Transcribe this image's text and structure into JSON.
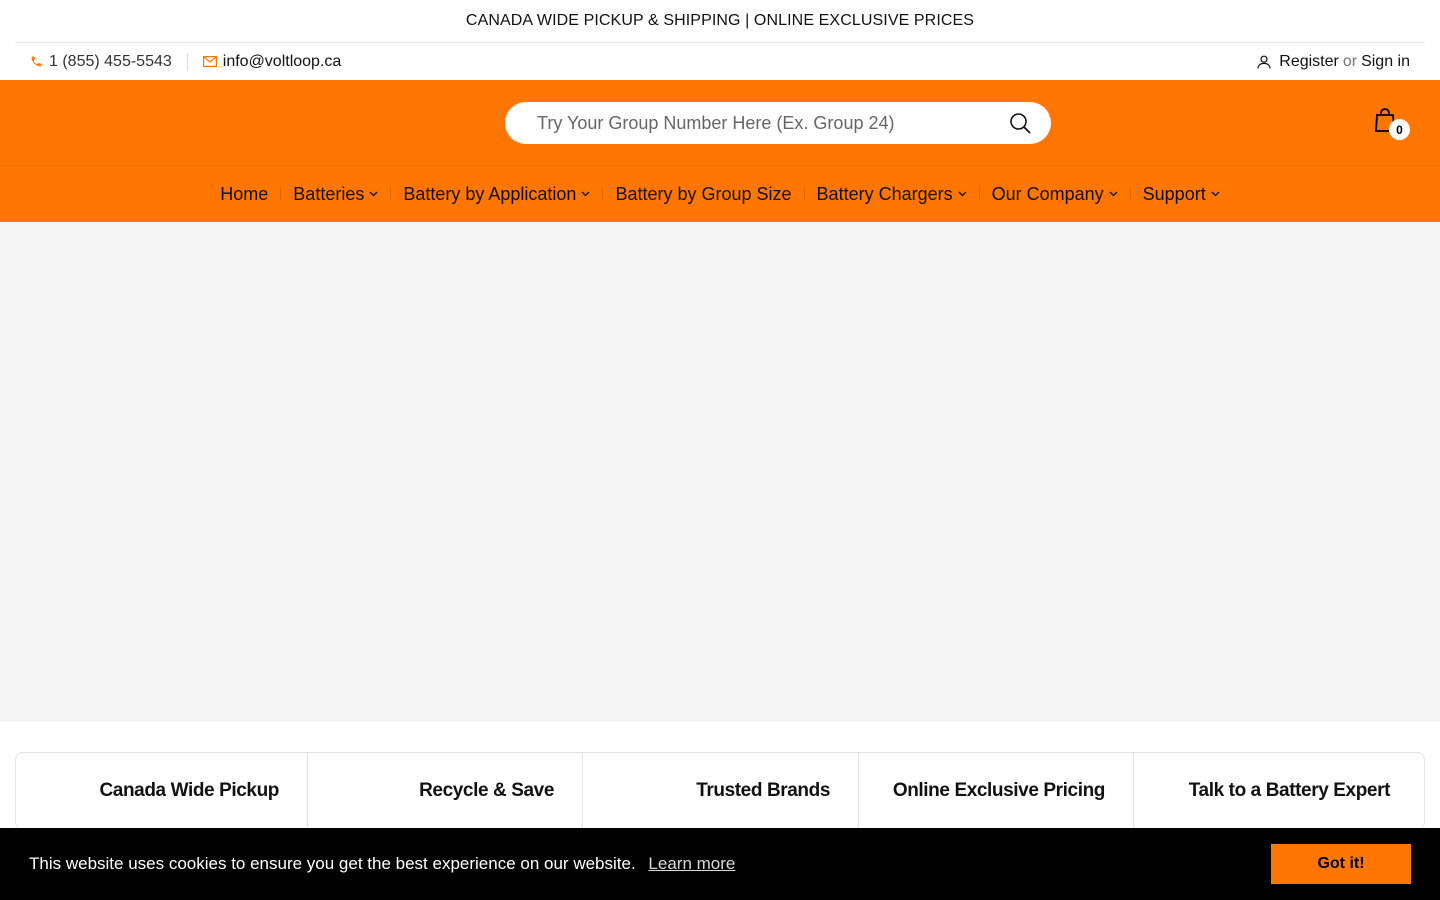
{
  "announcement": "CANADA WIDE PICKUP & SHIPPING | ONLINE EXCLUSIVE PRICES",
  "topbar": {
    "phone": "1 (855) 455-5543",
    "email": "info@voltloop.ca",
    "register": "Register",
    "or": "or",
    "signin": "Sign in"
  },
  "search": {
    "placeholder": "Try Your Group Number Here (Ex. Group 24)"
  },
  "cart": {
    "count": "0"
  },
  "nav": {
    "items": [
      {
        "label": "Home"
      },
      {
        "label": "Batteries"
      },
      {
        "label": "Battery by Application"
      },
      {
        "label": "Battery by Group Size"
      },
      {
        "label": "Battery Chargers"
      },
      {
        "label": "Our Company"
      },
      {
        "label": "Support"
      }
    ]
  },
  "features": [
    {
      "label": "Canada Wide Pickup"
    },
    {
      "label": "Recycle & Save"
    },
    {
      "label": "Trusted Brands"
    },
    {
      "label": "Online Exclusive Pricing"
    },
    {
      "label": "Talk to a Battery Expert"
    }
  ],
  "cookie": {
    "message": "This website uses cookies to ensure you get the best experience on our website.",
    "learn_more": "Learn more",
    "accept": "Got it!"
  },
  "colors": {
    "brand": "#ff7602",
    "hero_bg": "#f5f5f5",
    "cookie_bg": "#000000"
  }
}
